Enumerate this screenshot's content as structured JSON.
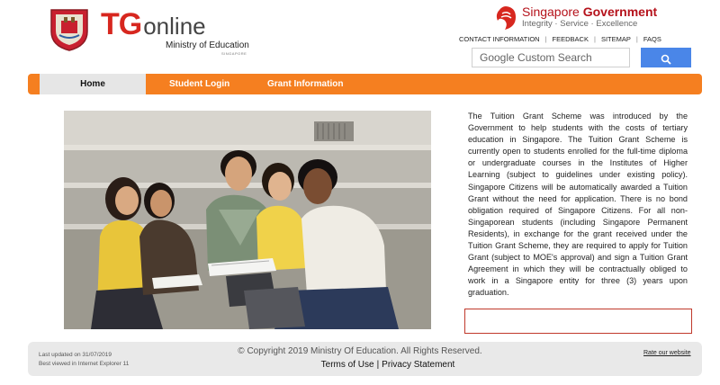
{
  "header": {
    "logo_tg": "TG",
    "logo_online": "online",
    "ministry": "Ministry of Education",
    "ministry_sub": "SINGAPORE",
    "gov_title_regular": "Singapore ",
    "gov_title_bold": "Government",
    "gov_motto": "Integrity · Service · Excellence",
    "links": [
      "CONTACT INFORMATION",
      "FEEDBACK",
      "SITEMAP",
      "FAQS"
    ],
    "link_separator": "|"
  },
  "search": {
    "placeholder": "Google Custom Search",
    "button_icon": "search-icon"
  },
  "nav": {
    "items": [
      "Home",
      "Student Login",
      "Grant Information"
    ],
    "active": "Home"
  },
  "main": {
    "intro_before": "The Tuition Grant Scheme was introduced by the Government to help students with the costs of tertiary education in Singapore. The Tuition Grant Scheme is currently open to students enrolled for the full-time diploma or undergraduate courses in the Institutes of Higher Learning (subject to guidelines under existing policy). Singapore Citizens will be automatically awarded a Tuition Grant without the need for application. There is no bond obligation required of Singapore Citizens. For all non-Singaporean students (including Singapore Permanent Residents), in exchange for the grant received under the Tuition Grant Scheme, they are required to apply for Tuition Grant (subject to MOE's approval) and sign a Tuition Grant Agreement in which they will be contractually obliged to ",
    "intro_highlight": "work in a Singapore entity for three (3) years upon graduation."
  },
  "footer": {
    "last_updated": "Last updated on 31/07/2019",
    "best_viewed": "Best viewed in Internet Explorer 11",
    "copyright": "© Copyright 2019 Ministry Of Education. All Rights Reserved.",
    "terms": "Terms of Use",
    "separator": "|",
    "privacy": "Privacy Statement",
    "rate": "Rate our website"
  },
  "colors": {
    "accent_orange": "#f57f20",
    "brand_red": "#d7271f",
    "search_blue": "#4a86e8",
    "highlight_border": "#c0392b"
  }
}
